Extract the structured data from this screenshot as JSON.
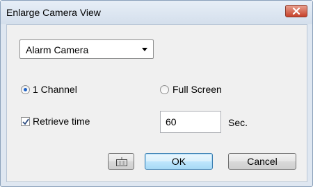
{
  "window": {
    "title": "Enlarge Camera View"
  },
  "camera_select": {
    "value": "Alarm Camera"
  },
  "view_mode": {
    "one_channel_label": "1 Channel",
    "full_screen_label": "Full Screen",
    "selected": "1 Channel"
  },
  "retrieve": {
    "label": "Retrieve time",
    "checked": true,
    "value": "60",
    "unit": "Sec."
  },
  "buttons": {
    "ok": "OK",
    "cancel": "Cancel"
  },
  "icons": {
    "close": "close-icon",
    "keyboard": "keyboard-icon"
  }
}
